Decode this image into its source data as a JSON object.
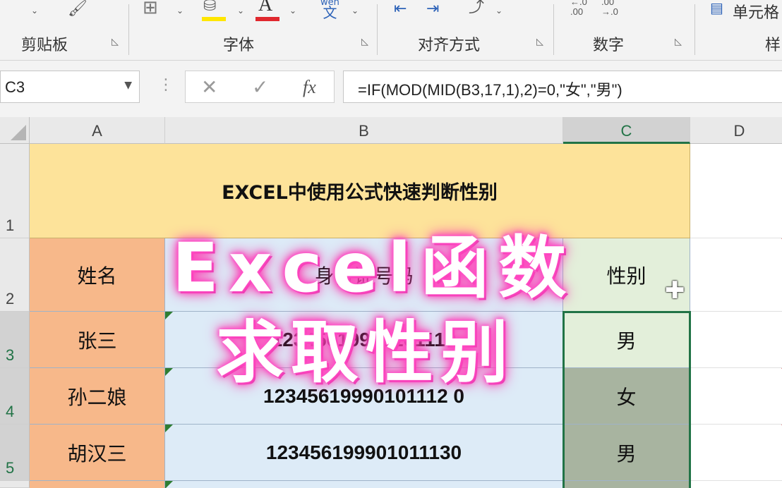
{
  "ribbon": {
    "groups": {
      "clipboard": "剪贴板",
      "font": "字体",
      "alignment": "对齐方式",
      "number": "数字",
      "styles_partial": "样"
    },
    "cell_format_partial": "单元格",
    "wrap_icon_text": "wén\n文",
    "dec_inc_text": "←.0\n.00",
    "dec_dec_text": ".00\n→.0"
  },
  "formula_bar": {
    "name_box": "C3",
    "fx": "fx",
    "formula": "=IF(MOD(MID(B3,17,1),2)=0,\"女\",\"男\")"
  },
  "columns": [
    "A",
    "B",
    "C",
    "D"
  ],
  "rows": [
    "1",
    "2",
    "3",
    "4",
    "5"
  ],
  "sheet": {
    "title": "EXCEL中使用公式快速判断性别",
    "headers": {
      "name": "姓名",
      "id": "身份证号码",
      "gender": "性别"
    },
    "records": [
      {
        "name": "张三",
        "id": "12345619990101110",
        "gender": "男"
      },
      {
        "name": "孙二娘",
        "id": "12345619990101112 0",
        "gender": "女"
      },
      {
        "name": "胡汉三",
        "id": "123456199901011130",
        "gender": "男"
      }
    ]
  },
  "overlay": {
    "line1": "Excel函数",
    "line2": "求取性别",
    "glow_color": "#ff4fc8"
  },
  "colors": {
    "title_fill": "#fde39a",
    "name_fill": "#f7b88a",
    "id_fill": "#ddebf7",
    "gender_fill": "#e3efda",
    "selection": "#217346"
  }
}
